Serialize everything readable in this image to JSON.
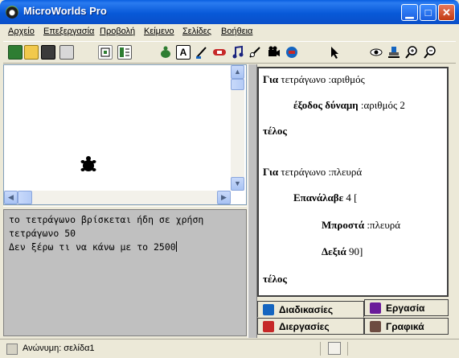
{
  "window": {
    "title": "MicroWorlds Pro",
    "controls": [
      "minimize",
      "maximize",
      "close"
    ]
  },
  "menu": [
    "Αρχείο",
    "Επεξεργασία",
    "Προβολή",
    "Κείμενο",
    "Σελίδες",
    "Βοήθεια"
  ],
  "toolbar": {
    "icons": [
      "new-page-icon",
      "open-icon",
      "save-icon",
      "print-icon",
      "page-view-icon",
      "procedures-view-icon",
      "turtle-icon",
      "textbox-icon",
      "paint-icon",
      "button-icon",
      "music-icon",
      "slider-icon",
      "video-icon",
      "sound-icon",
      "pointer-icon",
      "eye-icon",
      "stamp-icon",
      "zoom-in-icon",
      "zoom-out-icon"
    ]
  },
  "command_center": {
    "lines": [
      "το τετράγωνο βρίσκεται ήδη σε χρήση",
      "τετράγωνο 50",
      "Δεν ξέρω τι να κάνω με το 2500"
    ]
  },
  "procedures": {
    "line1_kw": "Για",
    "line1_rest": " τετράγωνο :αριθμός",
    "line2_kw": "έξοδος δύναμη",
    "line2_rest": " :αριθμός 2",
    "line3_kw": "τέλος",
    "line4_kw": "Για",
    "line4_rest": " τετράγωνο :πλευρά",
    "line5_kw": "Επανάλαβε",
    "line5_rest": " 4 [",
    "line6_kw": "Μπροστά",
    "line6_rest": " :πλευρά",
    "line7_kw": "Δεξιά",
    "line7_rest": " 90]",
    "line8_kw": "τέλος"
  },
  "tabs": {
    "procedures": "Διαδικασίες",
    "projects": "Εργασία",
    "processes": "Διεργασίες",
    "graphics": "Γραφικά"
  },
  "status": {
    "text": "Ανώνυμη:  σελίδα1"
  },
  "colors": {
    "titlebar": "#0a5fe0",
    "command_bg": "#c0c0c0"
  }
}
